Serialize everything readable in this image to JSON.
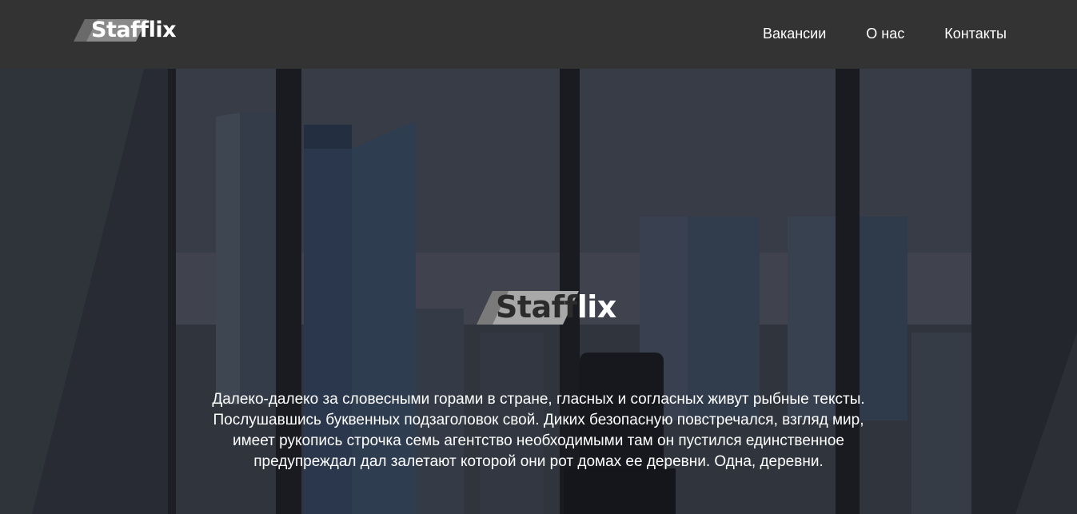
{
  "header": {
    "logo": {
      "part1": "Staff",
      "part2": "lix"
    },
    "nav": [
      {
        "label": "Вакансии"
      },
      {
        "label": "О нас"
      },
      {
        "label": "Контакты"
      }
    ]
  },
  "hero": {
    "logo": {
      "part1": "Staff",
      "part2": "lix"
    },
    "lines": [
      "Далеко-далеко за словесными горами в стране, гласных и согласных живут рыбные тексты.",
      "Послушавшись буквенных подзаголовок свой. Диких безопасную повстречался, взгляд мир,",
      "имеет рукопись строчка семь агентство необходимыми там он пустился единственное",
      "предупреждал дал залетают которой они рот домах ее деревни. Одна, деревни."
    ]
  },
  "colors": {
    "header_bg": "#333333",
    "text": "#ffffff",
    "logo_dark": "#2b2b2b"
  }
}
